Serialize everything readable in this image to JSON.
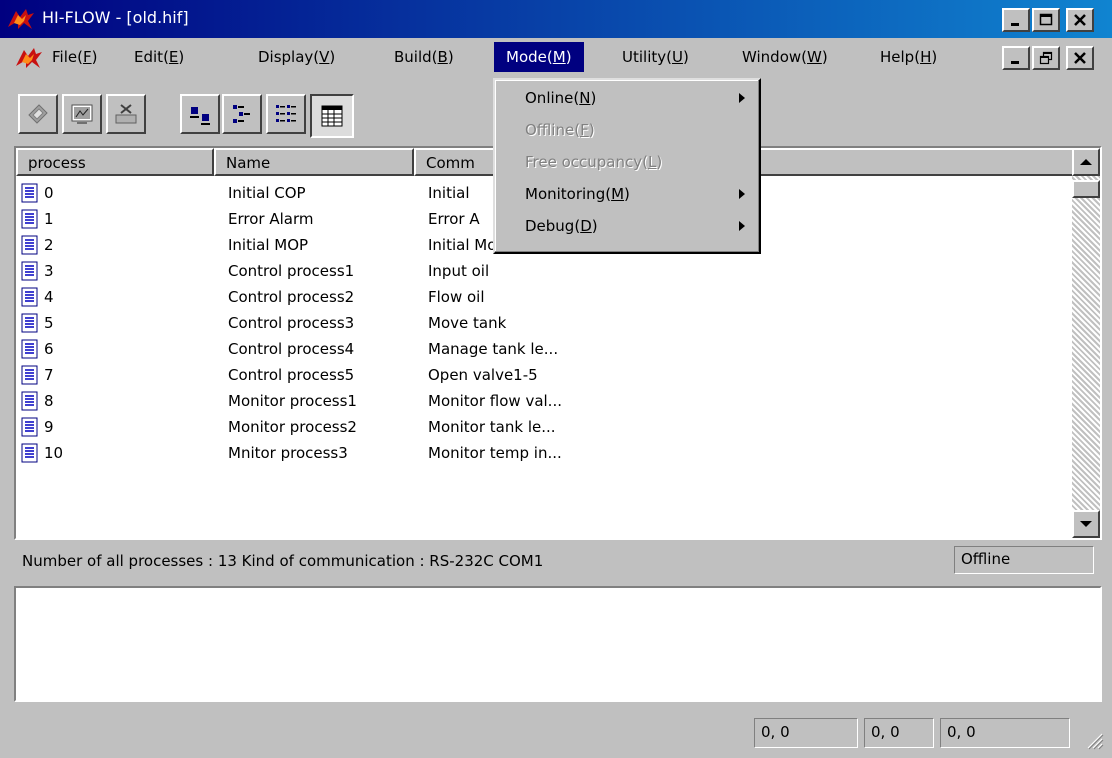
{
  "window": {
    "title": "HI-FLOW - [old.hif]"
  },
  "caption_buttons": [
    "minimize",
    "maximize",
    "close"
  ],
  "menubar": {
    "items": [
      {
        "label": "File",
        "key": "F"
      },
      {
        "label": "Edit",
        "key": "E"
      },
      {
        "label": "Display",
        "key": "V"
      },
      {
        "label": "Build",
        "key": "B"
      },
      {
        "label": "Mode",
        "key": "M"
      },
      {
        "label": "Utility",
        "key": "U"
      },
      {
        "label": "Window",
        "key": "W"
      },
      {
        "label": "Help",
        "key": "H"
      }
    ],
    "active": "Mode"
  },
  "mode_menu": {
    "items": [
      {
        "label": "Online",
        "key": "N",
        "enabled": true,
        "submenu": true
      },
      {
        "label": "Offline",
        "key": "F",
        "enabled": false,
        "submenu": false
      },
      {
        "label": "Free occupancy",
        "key": "L",
        "enabled": false,
        "submenu": false
      },
      {
        "label": "Monitoring",
        "key": "M",
        "enabled": true,
        "submenu": true
      },
      {
        "label": "Debug",
        "key": "D",
        "enabled": true,
        "submenu": true
      }
    ]
  },
  "toolbar": {
    "buttons": [
      {
        "icon": "download-icon",
        "pressed": false
      },
      {
        "icon": "monitor-icon",
        "pressed": false
      },
      {
        "icon": "eject-icon",
        "pressed": false
      },
      {
        "icon": "large-icons-view-icon",
        "pressed": false
      },
      {
        "icon": "small-icons-view-icon",
        "pressed": false
      },
      {
        "icon": "list-view-icon",
        "pressed": false
      },
      {
        "icon": "details-view-icon",
        "pressed": true
      }
    ]
  },
  "list": {
    "columns": [
      "process",
      "Name",
      "Comm"
    ],
    "rows": [
      {
        "process": "0",
        "name": "Initial COP",
        "comment": "Initial"
      },
      {
        "process": "1",
        "name": "Error Alarm",
        "comment": "Error A"
      },
      {
        "process": "2",
        "name": "Initial MOP",
        "comment": "Initial Monitor p..."
      },
      {
        "process": "3",
        "name": "Control process1",
        "comment": "Input oil"
      },
      {
        "process": "4",
        "name": "Control process2",
        "comment": "Flow oil"
      },
      {
        "process": "5",
        "name": "Control process3",
        "comment": "Move tank"
      },
      {
        "process": "6",
        "name": "Control process4",
        "comment": "Manage tank le..."
      },
      {
        "process": "7",
        "name": "Control process5",
        "comment": "Open valve1-5"
      },
      {
        "process": "8",
        "name": "Monitor process1",
        "comment": "Monitor flow val..."
      },
      {
        "process": "9",
        "name": "Monitor process2",
        "comment": "Monitor tank le..."
      },
      {
        "process": "10",
        "name": "Mnitor process3",
        "comment": "Monitor temp in..."
      }
    ]
  },
  "status_line": {
    "text": "Number of all processes : 13 Kind of communication : RS-232C COM1",
    "mode": "Offline"
  },
  "statusbar": {
    "coords": [
      "0, 0",
      "0, 0",
      "0, 0"
    ]
  },
  "colors": {
    "title_bar": "#000080",
    "face": "#c0c0c0",
    "highlight": "#000080",
    "disabled_text": "#808080"
  }
}
